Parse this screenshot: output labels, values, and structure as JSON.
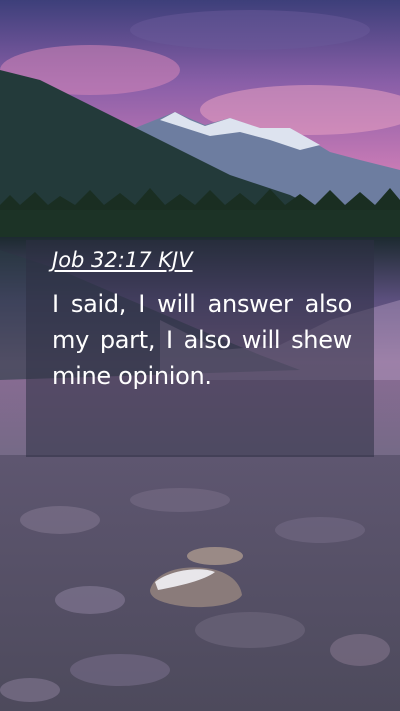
{
  "reference": "Job 32:17 KJV",
  "verse_text": "I said, I will answer also my part, I also will shew mine opinion.",
  "colors": {
    "sky_top": "#3d3f7a",
    "sky_pink": "#c77ab5",
    "mountain_dark": "#1f3a35",
    "lake": "#3a4a6a",
    "card_overlay": "rgba(45,48,68,0.55)",
    "text": "#ffffff"
  }
}
